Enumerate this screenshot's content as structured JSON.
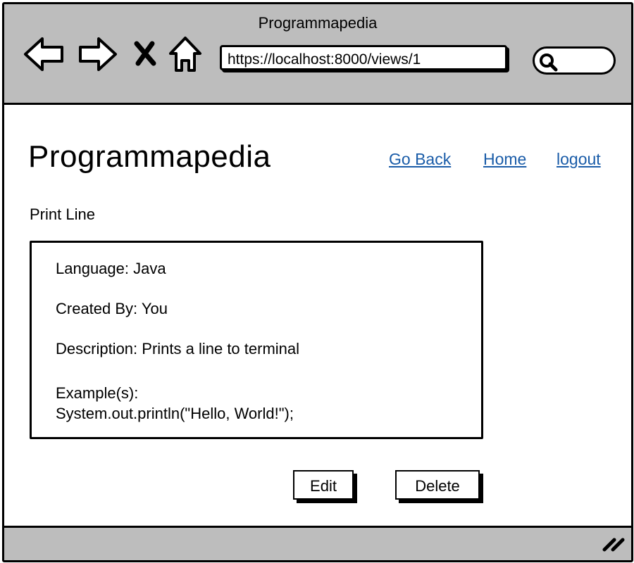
{
  "window": {
    "title": "Programmapedia",
    "url": "https://localhost:8000/views/1"
  },
  "icons": {
    "back": "arrow-left-icon",
    "forward": "arrow-right-icon",
    "stop": "close-icon",
    "home": "home-icon",
    "search": "search-icon",
    "resize": "resize-grip-icon"
  },
  "header": {
    "site_title": "Programmapedia",
    "links": [
      {
        "label": "Go Back"
      },
      {
        "label": "Home"
      },
      {
        "label": "logout"
      }
    ]
  },
  "entry": {
    "name": "Print Line",
    "language_line": "Language: Java",
    "created_by_line": "Created By: You",
    "description_line": "Description: Prints a line to terminal",
    "examples_label": "Example(s):",
    "example_code": "System.out.println(\"Hello, World!\");"
  },
  "actions": {
    "edit_label": "Edit",
    "delete_label": "Delete"
  },
  "colors": {
    "chrome": "#bdbdbd",
    "link": "#1a5ca8"
  }
}
